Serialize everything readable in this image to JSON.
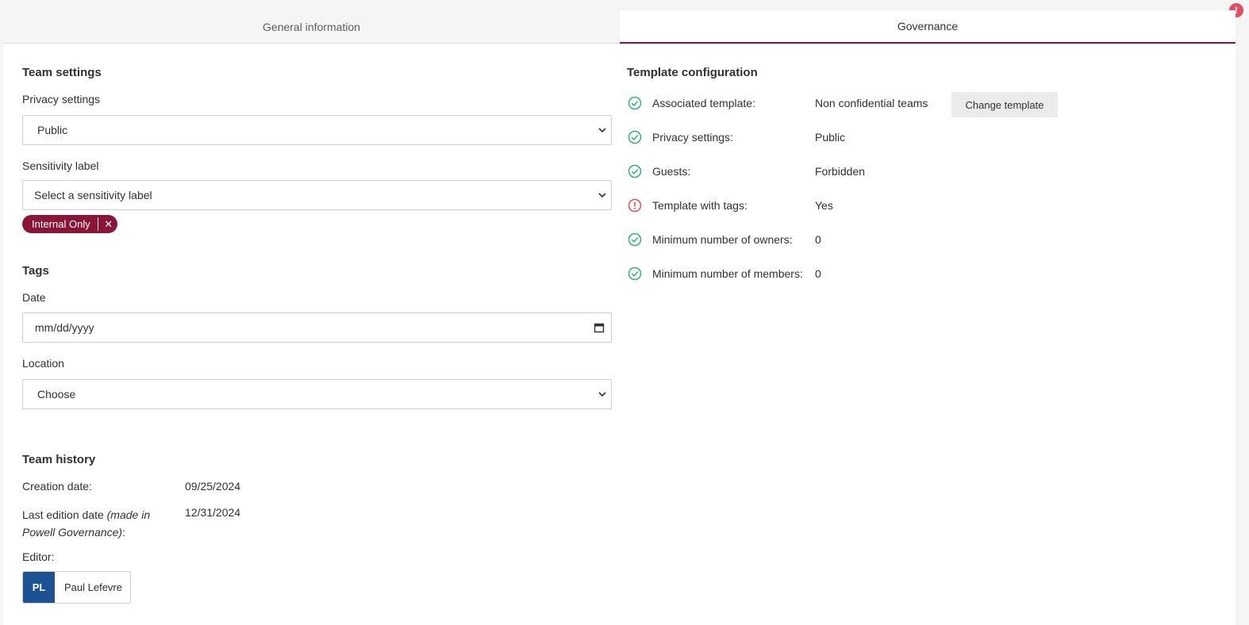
{
  "tabs": {
    "general": "General information",
    "governance": "Governance"
  },
  "team_settings": {
    "title": "Team settings",
    "privacy_label": "Privacy settings",
    "privacy_value": "Public",
    "sensitivity_label": "Sensitivity label",
    "sensitivity_placeholder": "Select a sensitivity label",
    "sensitivity_chip": "Internal Only",
    "chip_remove": "✕"
  },
  "tags": {
    "title": "Tags",
    "date_label": "Date",
    "date_placeholder": "mm/dd/yyyy",
    "location_label": "Location",
    "location_value": "Choose"
  },
  "history": {
    "title": "Team history",
    "creation_label": "Creation date:",
    "creation_value": "09/25/2024",
    "last_edit_label": "Last edition date",
    "last_edit_note": "(made in Powell Governance)",
    "last_edit_suffix": ":",
    "last_edit_value": "12/31/2024",
    "editor_label": "Editor:",
    "editor_initials": "PL",
    "editor_name": "Paul Lefevre"
  },
  "governance": {
    "title": "Template configuration",
    "change_button": "Change template",
    "rows": [
      {
        "label": "Associated template:",
        "value": "Non confidential teams",
        "status": "ok"
      },
      {
        "label": "Privacy settings:",
        "value": "Public",
        "status": "ok"
      },
      {
        "label": "Guests:",
        "value": "Forbidden",
        "status": "ok"
      },
      {
        "label": "Template with tags:",
        "value": "Yes",
        "status": "warning"
      },
      {
        "label": "Minimum number of owners:",
        "value": "0",
        "status": "ok"
      },
      {
        "label": "Minimum number of members:",
        "value": "0",
        "status": "ok"
      }
    ]
  },
  "alert_badge": "!",
  "colors": {
    "accent": "#8a1538",
    "ok": "#2fb36e",
    "warning": "#e04f5f",
    "avatar": "#1b5294"
  }
}
